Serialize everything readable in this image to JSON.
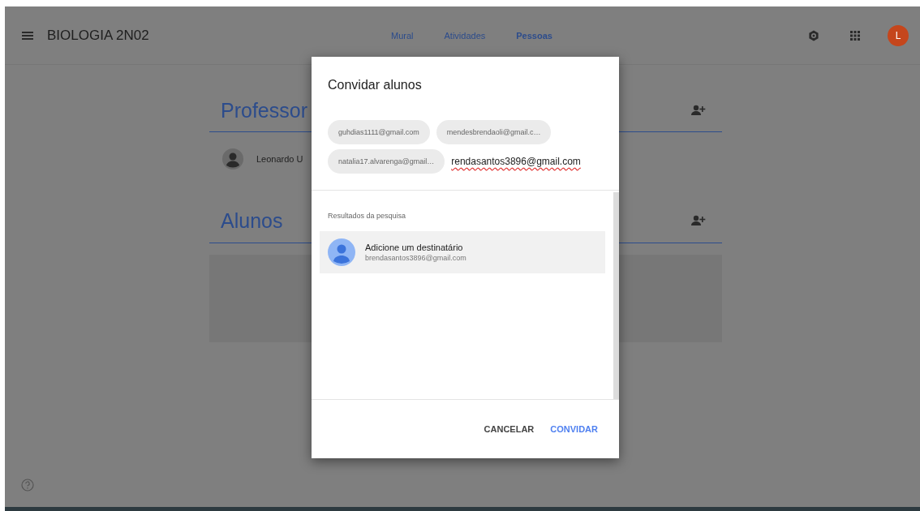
{
  "header": {
    "title": "BIOLOGIA 2N02",
    "avatar_letter": "L",
    "tabs": [
      {
        "label": "Mural",
        "selected": false
      },
      {
        "label": "Atividades",
        "selected": false
      },
      {
        "label": "Pessoas",
        "selected": true
      }
    ]
  },
  "sections": [
    {
      "heading": "Professor",
      "people": [
        {
          "name": "Leonardo U"
        }
      ]
    },
    {
      "heading": "Alunos"
    }
  ],
  "dialog": {
    "title": "Convidar alunos",
    "recipients": [
      {
        "label": "guhdias1111@gmail.com"
      },
      {
        "label": "mendesbrendaoli@gmail.c…"
      },
      {
        "label": "natalia17.alvarenga@gmail…"
      }
    ],
    "query": "rendasantos3896@gmail.com",
    "results_label": "Resultados da pesquisa",
    "results": [
      {
        "title": "Adicione um destinatário",
        "email": "brendasantos3896@gmail.com"
      }
    ],
    "buttons": [
      {
        "label": "CANCELAR",
        "kind": "secondary"
      },
      {
        "label": "CONVIDAR",
        "kind": "primary"
      }
    ]
  }
}
